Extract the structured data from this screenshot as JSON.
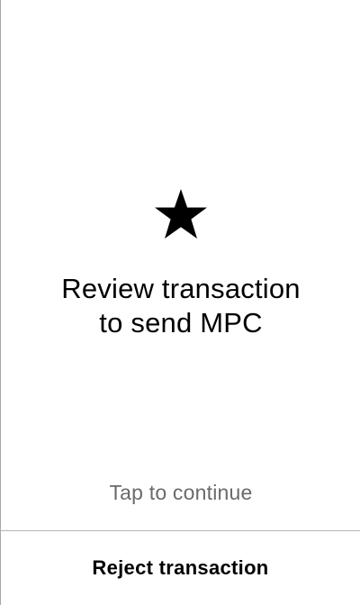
{
  "main": {
    "icon": "star-icon",
    "title_line1": "Review transaction",
    "title_line2": "to send MPC",
    "tap_hint": "Tap to continue"
  },
  "footer": {
    "reject_label": "Reject transaction"
  },
  "colors": {
    "text": "#000000",
    "hint": "#6a6a6a",
    "divider": "#b4b4b4",
    "background": "#ffffff"
  }
}
